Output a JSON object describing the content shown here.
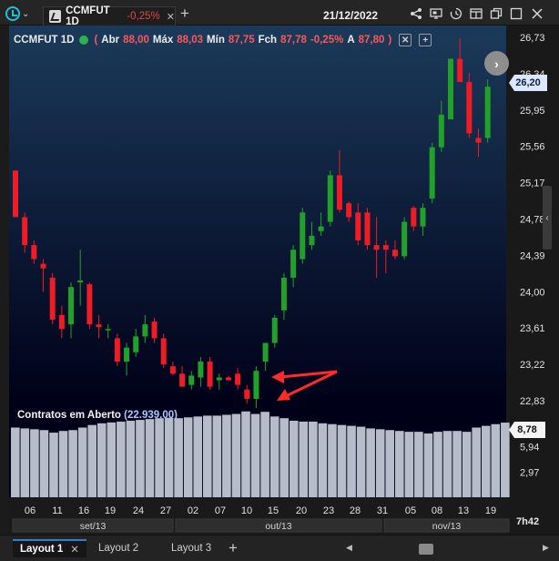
{
  "header": {
    "tab_symbol": "CCMFUT 1D",
    "tab_change": "-0,25%",
    "tab_close": "✕",
    "add_tab": "+",
    "date": "21/12/2022"
  },
  "legend": {
    "symbol": "CCMFUT 1D",
    "open_label": "Abr",
    "open_value": "88,00",
    "high_label": "Máx",
    "high_value": "88,03",
    "low_label": "Mín",
    "low_value": "87,75",
    "close_label": "Fch",
    "close_value": "87,78",
    "change": "-0,25%",
    "last_label": "A",
    "last_value": "87,80",
    "open_paren": "(",
    "close_paren": ")",
    "close_btn": "✕",
    "add_btn": "+"
  },
  "indicator": {
    "label": "Contratos em Aberto",
    "value": "(22.939,00)"
  },
  "price_tag": "26,20",
  "volume_tag": "8,78",
  "time_label": "7h42",
  "footer": {
    "layouts": [
      {
        "label": "Layout 1",
        "active": true
      },
      {
        "label": "Layout 2",
        "active": false
      },
      {
        "label": "Layout 3",
        "active": false
      }
    ],
    "close": "✕",
    "add": "+"
  },
  "colors": {
    "up": "#22a12a",
    "down": "#ee1c24",
    "volume_bar": "#b6bcc8",
    "arrow": "#ff2a2a",
    "accent": "#19c3dc"
  },
  "chart_data": {
    "type": "candlestick",
    "price_axis": [
      "26,73",
      "26,34",
      "25,95",
      "25,56",
      "25,17",
      "24,78",
      "24,39",
      "24,00",
      "23,61",
      "23,22",
      "22,83"
    ],
    "volume_axis": [
      "5,94",
      "2,97"
    ],
    "x_ticks": [
      "06",
      "11",
      "16",
      "19",
      "24",
      "27",
      "02",
      "07",
      "10",
      "13",
      "15",
      "20",
      "23",
      "28",
      "31",
      "05",
      "08",
      "13",
      "19"
    ],
    "months": [
      "set/13",
      "out/13",
      "nov/13"
    ],
    "candles": [
      {
        "o": 25.3,
        "h": 25.3,
        "l": 24.8,
        "c": 24.8
      },
      {
        "o": 24.8,
        "h": 24.85,
        "l": 24.42,
        "c": 24.5
      },
      {
        "o": 24.5,
        "h": 24.55,
        "l": 24.3,
        "c": 24.35
      },
      {
        "o": 24.3,
        "h": 24.35,
        "l": 24.0,
        "c": 24.25
      },
      {
        "o": 24.15,
        "h": 24.2,
        "l": 23.65,
        "c": 23.7
      },
      {
        "o": 23.75,
        "h": 23.85,
        "l": 23.5,
        "c": 23.6
      },
      {
        "o": 23.65,
        "h": 24.1,
        "l": 23.5,
        "c": 24.05
      },
      {
        "o": 24.1,
        "h": 24.45,
        "l": 23.85,
        "c": 24.12
      },
      {
        "o": 24.08,
        "h": 24.1,
        "l": 23.6,
        "c": 23.65
      },
      {
        "o": 23.65,
        "h": 23.75,
        "l": 23.5,
        "c": 23.62
      },
      {
        "o": 23.6,
        "h": 23.65,
        "l": 23.5,
        "c": 23.6
      },
      {
        "o": 23.5,
        "h": 23.55,
        "l": 23.2,
        "c": 23.25
      },
      {
        "o": 23.25,
        "h": 23.45,
        "l": 23.1,
        "c": 23.4
      },
      {
        "o": 23.35,
        "h": 23.6,
        "l": 23.3,
        "c": 23.52
      },
      {
        "o": 23.52,
        "h": 23.75,
        "l": 23.45,
        "c": 23.65
      },
      {
        "o": 23.68,
        "h": 23.72,
        "l": 23.45,
        "c": 23.5
      },
      {
        "o": 23.5,
        "h": 23.55,
        "l": 23.18,
        "c": 23.22
      },
      {
        "o": 23.2,
        "h": 23.25,
        "l": 23.1,
        "c": 23.12
      },
      {
        "o": 23.12,
        "h": 23.2,
        "l": 22.98,
        "c": 22.98
      },
      {
        "o": 23.0,
        "h": 23.15,
        "l": 22.95,
        "c": 23.1
      },
      {
        "o": 23.08,
        "h": 23.3,
        "l": 22.98,
        "c": 23.25
      },
      {
        "o": 23.25,
        "h": 23.3,
        "l": 22.95,
        "c": 22.98
      },
      {
        "o": 23.05,
        "h": 23.12,
        "l": 22.95,
        "c": 23.08
      },
      {
        "o": 23.08,
        "h": 23.1,
        "l": 23.05,
        "c": 23.05
      },
      {
        "o": 23.12,
        "h": 23.18,
        "l": 22.95,
        "c": 23.0
      },
      {
        "o": 22.95,
        "h": 23.0,
        "l": 22.8,
        "c": 22.85
      },
      {
        "o": 22.85,
        "h": 23.2,
        "l": 22.75,
        "c": 23.15
      },
      {
        "o": 23.25,
        "h": 23.45,
        "l": 23.15,
        "c": 23.45
      },
      {
        "o": 23.45,
        "h": 23.75,
        "l": 23.4,
        "c": 23.72
      },
      {
        "o": 23.8,
        "h": 24.2,
        "l": 23.7,
        "c": 24.15
      },
      {
        "o": 24.15,
        "h": 24.5,
        "l": 24.05,
        "c": 24.45
      },
      {
        "o": 24.35,
        "h": 24.9,
        "l": 24.3,
        "c": 24.85
      },
      {
        "o": 24.5,
        "h": 24.75,
        "l": 24.45,
        "c": 24.6
      },
      {
        "o": 24.65,
        "h": 24.85,
        "l": 24.6,
        "c": 24.7
      },
      {
        "o": 24.75,
        "h": 25.3,
        "l": 24.7,
        "c": 25.25
      },
      {
        "o": 25.25,
        "h": 25.52,
        "l": 24.85,
        "c": 24.88
      },
      {
        "o": 24.95,
        "h": 24.97,
        "l": 24.75,
        "c": 24.8
      },
      {
        "o": 24.85,
        "h": 24.95,
        "l": 24.5,
        "c": 24.55
      },
      {
        "o": 24.85,
        "h": 24.9,
        "l": 24.45,
        "c": 24.5
      },
      {
        "o": 24.5,
        "h": 24.8,
        "l": 24.15,
        "c": 24.45
      },
      {
        "o": 24.5,
        "h": 24.55,
        "l": 24.2,
        "c": 24.45
      },
      {
        "o": 24.45,
        "h": 24.55,
        "l": 24.35,
        "c": 24.38
      },
      {
        "o": 24.38,
        "h": 24.8,
        "l": 24.35,
        "c": 24.75
      },
      {
        "o": 24.9,
        "h": 24.92,
        "l": 24.65,
        "c": 24.7
      },
      {
        "o": 24.7,
        "h": 24.95,
        "l": 24.6,
        "c": 24.9
      },
      {
        "o": 25.0,
        "h": 25.6,
        "l": 24.95,
        "c": 25.55
      },
      {
        "o": 25.55,
        "h": 26.05,
        "l": 25.5,
        "c": 25.9
      },
      {
        "o": 25.85,
        "h": 26.5,
        "l": 25.85,
        "c": 26.5
      },
      {
        "o": 26.5,
        "h": 26.72,
        "l": 26.25,
        "c": 26.25
      },
      {
        "o": 26.25,
        "h": 26.35,
        "l": 25.65,
        "c": 25.7
      },
      {
        "o": 25.65,
        "h": 25.75,
        "l": 25.45,
        "c": 25.6
      },
      {
        "o": 25.65,
        "h": 26.28,
        "l": 25.6,
        "c": 26.2
      }
    ],
    "open_interest": [
      8.2,
      8.1,
      8.0,
      7.9,
      7.6,
      7.8,
      7.9,
      8.2,
      8.5,
      8.7,
      8.8,
      8.9,
      9.0,
      9.1,
      9.2,
      9.3,
      9.35,
      9.3,
      9.4,
      9.5,
      9.6,
      9.6,
      9.7,
      9.8,
      10.1,
      9.8,
      10.05,
      9.5,
      9.3,
      9.0,
      8.9,
      8.9,
      8.7,
      8.6,
      8.5,
      8.4,
      8.3,
      8.1,
      8.0,
      7.9,
      7.8,
      7.7,
      7.7,
      7.5,
      7.7,
      7.8,
      7.8,
      7.7,
      8.2,
      8.4,
      8.6,
      8.78
    ],
    "volume_range": [
      0,
      10.5
    ]
  }
}
